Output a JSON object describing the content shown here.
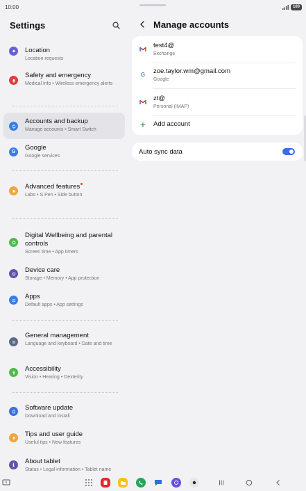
{
  "status_bar": {
    "time": "10:00",
    "battery": "100"
  },
  "left_pane": {
    "title": "Settings",
    "items": [
      {
        "title": "Location",
        "subtitle": "Location requests",
        "color": "#6a5fd6"
      },
      {
        "title": "Safety and emergency",
        "subtitle": "Medical info  •  Wireless emergency alerts",
        "color": "#e23b3b"
      },
      {
        "title": "Accounts and backup",
        "subtitle": "Manage accounts  •  Smart Switch",
        "color": "#3b7de0"
      },
      {
        "title": "Google",
        "subtitle": "Google services",
        "color": "#3b7de0"
      },
      {
        "title": "Advanced features",
        "subtitle": "Labs  •  S Pen  •  Side button",
        "color": "#f0a63a"
      },
      {
        "title": "Digital Wellbeing and parental controls",
        "subtitle": "Screen time  •  App timers",
        "color": "#4cba4c"
      },
      {
        "title": "Device care",
        "subtitle": "Storage  •  Memory  •  App protection",
        "color": "#5e56a8"
      },
      {
        "title": "Apps",
        "subtitle": "Default apps  •  App settings",
        "color": "#3b7de0"
      },
      {
        "title": "General management",
        "subtitle": "Language and keyboard  •  Date and time",
        "color": "#5e6a85"
      },
      {
        "title": "Accessibility",
        "subtitle": "Vision  •  Hearing  •  Dexterity",
        "color": "#4cba4c"
      },
      {
        "title": "Software update",
        "subtitle": "Download and install",
        "color": "#3b6fe0"
      },
      {
        "title": "Tips and user guide",
        "subtitle": "Useful tips  •  New features",
        "color": "#f0a63a"
      },
      {
        "title": "About tablet",
        "subtitle": "Status  •  Legal information  •  Tablet name",
        "color": "#5e56a8"
      }
    ]
  },
  "right_pane": {
    "title": "Manage accounts",
    "accounts": [
      {
        "name": "test4@",
        "type": "Exchange"
      },
      {
        "name": "zoe.taylor.wm@gmail.com",
        "type": "Google"
      },
      {
        "name": "zt@",
        "type": "Personal (IMAP)"
      }
    ],
    "add_account_label": "Add account",
    "auto_sync_label": "Auto sync data",
    "auto_sync_on": true
  },
  "colors": {
    "accent": "#3b6fe0",
    "background": "#f2f2f4",
    "card": "#ffffff"
  }
}
